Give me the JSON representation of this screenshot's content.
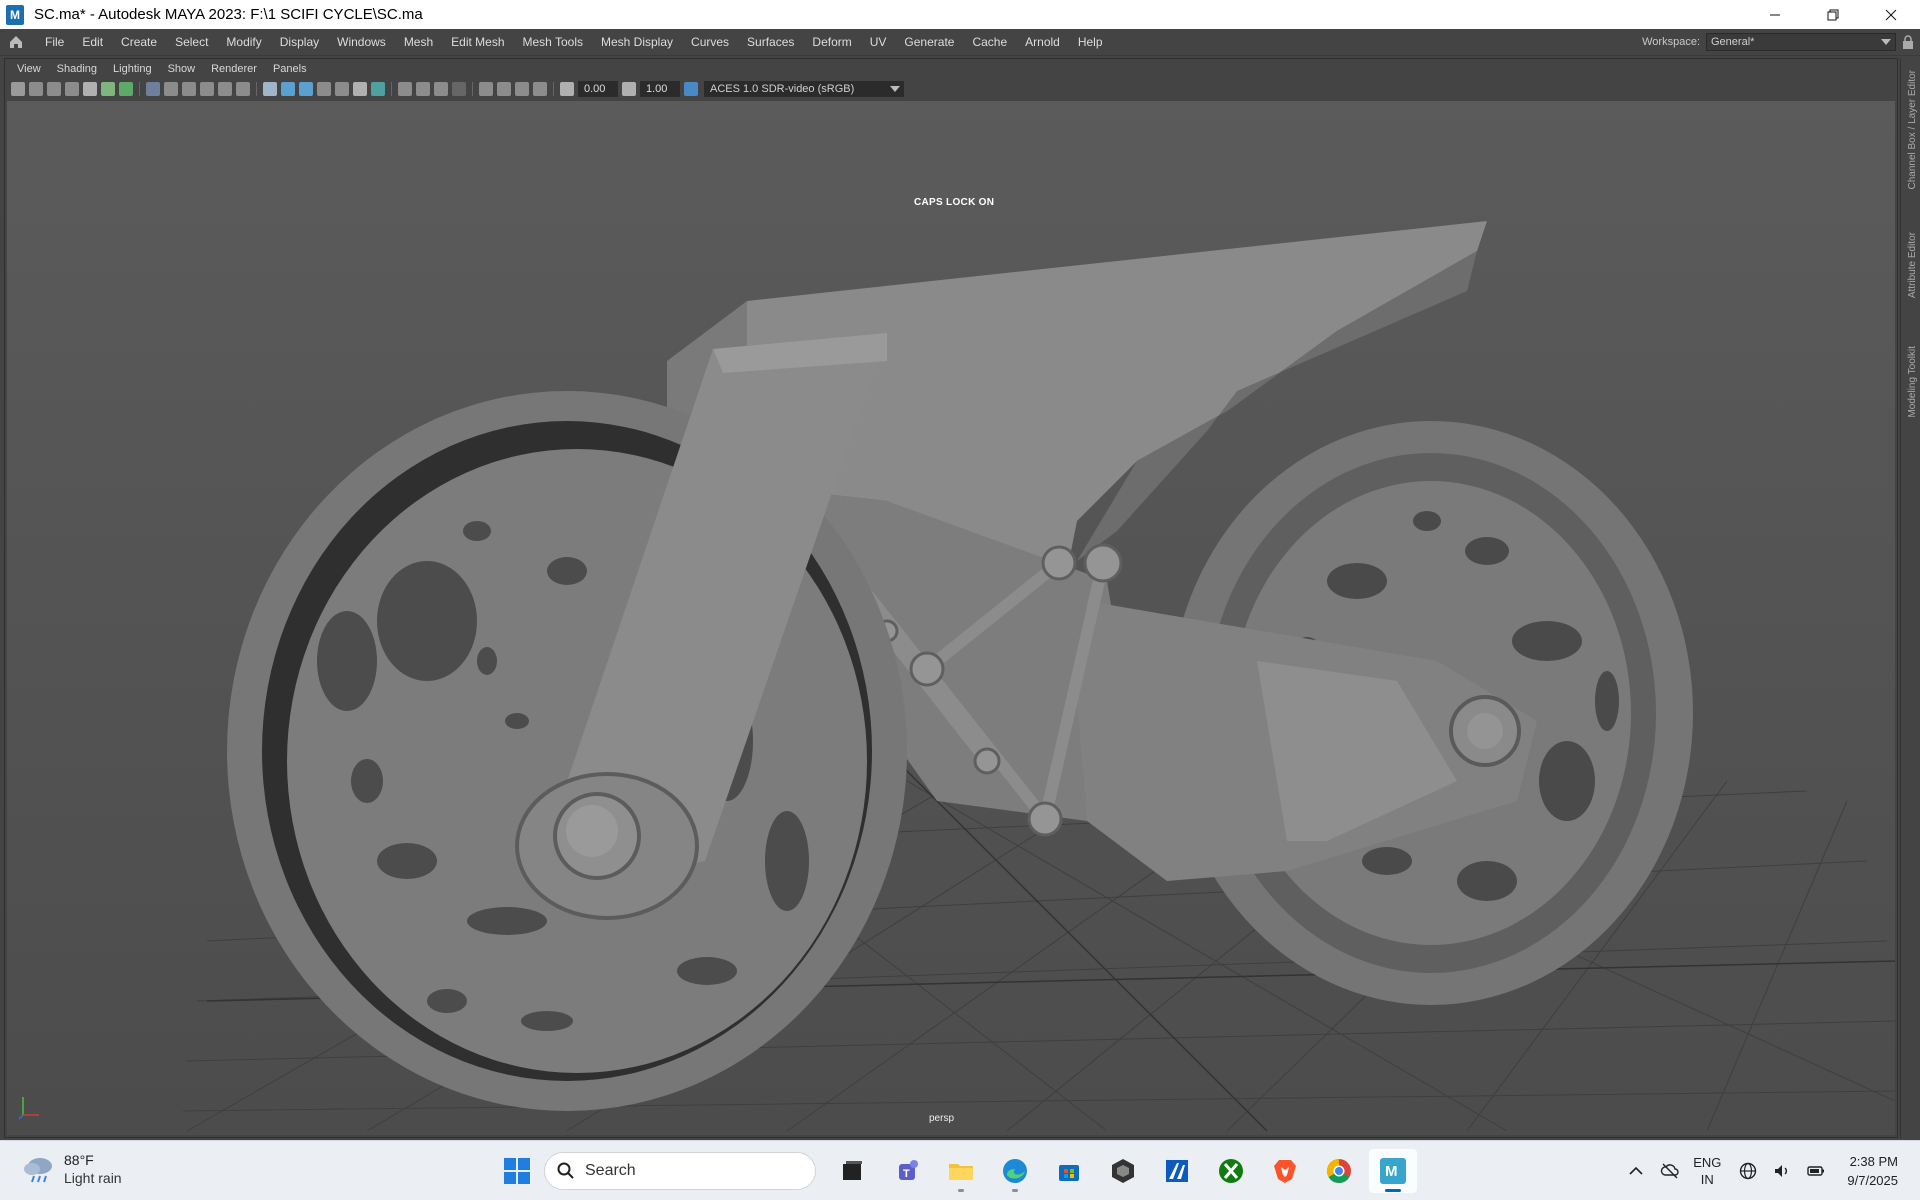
{
  "window": {
    "title": "SC.ma* - Autodesk MAYA 2023: F:\\1 SCIFI CYCLE\\SC.ma",
    "app_icon_letter": "M",
    "controls": [
      "minimize",
      "restore",
      "close"
    ]
  },
  "menubar": {
    "items": [
      "File",
      "Edit",
      "Create",
      "Select",
      "Modify",
      "Display",
      "Windows",
      "Mesh",
      "Edit Mesh",
      "Mesh Tools",
      "Mesh Display",
      "Curves",
      "Surfaces",
      "Deform",
      "UV",
      "Generate",
      "Cache",
      "Arnold",
      "Help"
    ],
    "workspace_label": "Workspace:",
    "workspace_value": "General*"
  },
  "panel": {
    "menu": [
      "View",
      "Shading",
      "Lighting",
      "Show",
      "Renderer",
      "Panels"
    ],
    "toolbar": {
      "field1": "0.00",
      "field2": "1.00",
      "colorspace": "ACES 1.0 SDR-video (sRGB)"
    }
  },
  "viewport": {
    "hud_message": "CAPS LOCK ON",
    "camera_name": "persp",
    "model_name": "SCIFI CYCLE"
  },
  "side_tabs": [
    "Channel Box / Layer Editor",
    "Attribute Editor",
    "Modeling Toolkit"
  ],
  "taskbar": {
    "weather": {
      "temp": "88°F",
      "condition": "Light rain"
    },
    "search_label": "Search",
    "apps": [
      "file-explorer-blank",
      "teams",
      "file-explorer",
      "edge",
      "microsoft-store",
      "unity",
      "autodesk-app",
      "xbox",
      "brave",
      "chrome",
      "maya"
    ],
    "active_app": "maya",
    "language": {
      "line1": "ENG",
      "line2": "IN"
    },
    "time": "2:38 PM",
    "date": "9/7/2025"
  },
  "colors": {
    "maya_bg": "#444444",
    "viewport_bg": "#5b5b5b",
    "taskbar_bg": "#ebeff4",
    "accent": "#0067c0"
  }
}
